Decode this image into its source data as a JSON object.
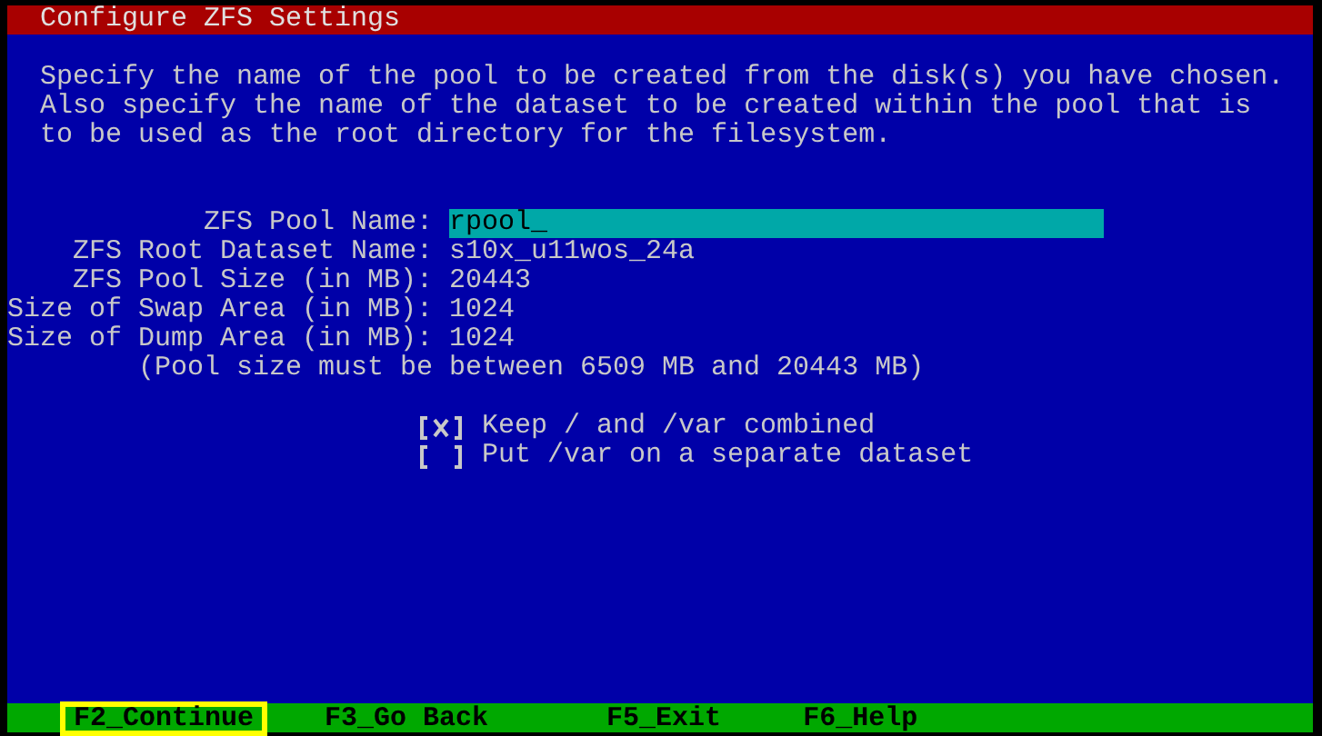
{
  "window": {
    "title": "Configure ZFS Settings"
  },
  "description": [
    "Specify the name of the pool to be created from the disk(s) you have chosen.",
    "Also specify the name of the dataset to be created within the pool that is",
    "to be used as the root directory for the filesystem."
  ],
  "fields": [
    {
      "label": "ZFS Pool Name:",
      "value": "rpool_",
      "kind": "input"
    },
    {
      "label": "ZFS Root Dataset Name:",
      "value": "s10x_u11wos_24a",
      "kind": "text"
    },
    {
      "label": "ZFS Pool Size (in MB):",
      "value": "20443",
      "kind": "text"
    },
    {
      "label": "Size of Swap Area (in MB):",
      "value": "1024",
      "kind": "text"
    },
    {
      "label": "Size of Dump Area (in MB):",
      "value": "1024",
      "kind": "text"
    }
  ],
  "note": "(Pool size must be between 6509 MB and 20443 MB)",
  "options": [
    {
      "checked": true,
      "label": "Keep / and /var combined"
    },
    {
      "checked": false,
      "label": "Put /var on a separate dataset"
    }
  ],
  "function_keys": [
    {
      "label": "F2_Continue",
      "selected": true
    },
    {
      "label": "F3_Go Back",
      "selected": false
    },
    {
      "label": "F5_Exit",
      "selected": false
    },
    {
      "label": "F6_Help",
      "selected": false
    }
  ]
}
